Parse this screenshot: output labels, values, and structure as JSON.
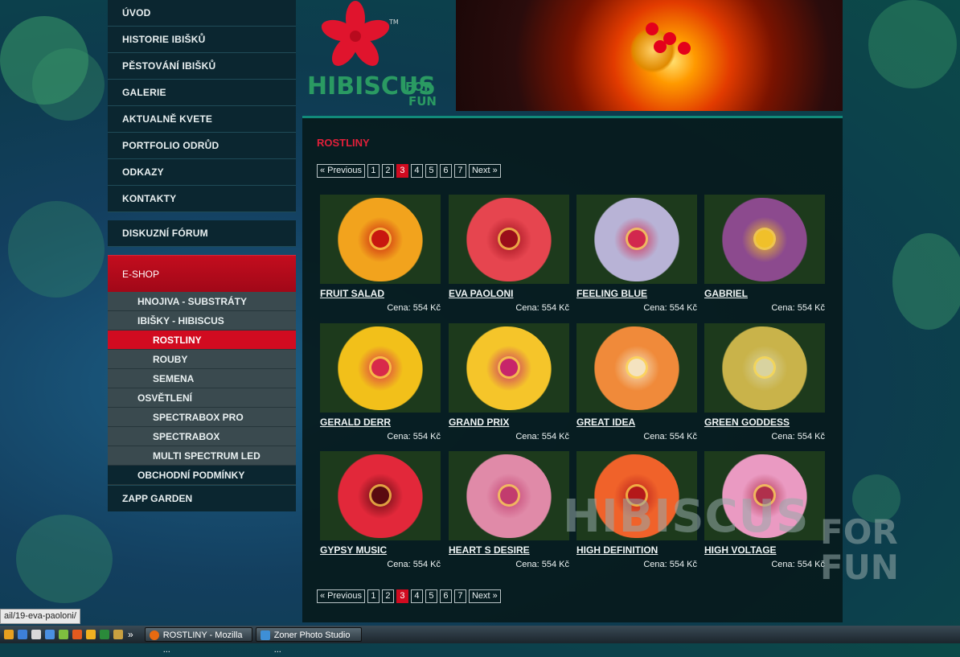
{
  "nav": {
    "main": [
      "ÚVOD",
      "HISTORIE IBIŠKŮ",
      "PĚSTOVÁNÍ IBIŠKŮ",
      "GALERIE",
      "AKTUALNĚ KVETE",
      "PORTFOLIO ODRŮD",
      "ODKAZY",
      "KONTAKTY"
    ],
    "forum": "DISKUZNÍ FÓRUM",
    "eshop": "E-SHOP",
    "sub": [
      {
        "label": "HNOJIVA - SUBSTRÁTY",
        "level": 2
      },
      {
        "label": "IBIŠKY - HIBISCUS",
        "level": 2
      },
      {
        "label": "ROSTLINY",
        "level": 3,
        "active": true
      },
      {
        "label": "ROUBY",
        "level": 3
      },
      {
        "label": "SEMENA",
        "level": 3
      },
      {
        "label": "OSVĚTLENÍ",
        "level": 2
      },
      {
        "label": "SPECTRABOX PRO",
        "level": 3
      },
      {
        "label": "SPECTRABOX",
        "level": 3
      },
      {
        "label": "MULTI SPECTRUM LED",
        "level": 3
      },
      {
        "label": "OBCHODNÍ PODMÍNKY",
        "level": 2,
        "dark": true
      }
    ],
    "zapp": "ZAPP GARDEN"
  },
  "logo": {
    "main": "HIBISCUS",
    "for": "FOR",
    "fun": "FUN",
    "tm": "TM"
  },
  "heading": "ROSTLINY",
  "pager": {
    "prev": "« Previous",
    "pages": [
      "1",
      "2",
      "3",
      "4",
      "5",
      "6",
      "7"
    ],
    "current": "3",
    "next": "Next »"
  },
  "products": [
    {
      "name": "FRUIT SALAD",
      "price": "Cena: 554 Kč",
      "petal": "#f2a31d",
      "eye": "#c8180f"
    },
    {
      "name": "EVA PAOLONI",
      "price": "Cena: 554 Kč",
      "petal": "#e6454f",
      "eye": "#9a0d1a"
    },
    {
      "name": "FEELING BLUE",
      "price": "Cena: 554 Kč",
      "petal": "#b8b3d6",
      "eye": "#d2284e"
    },
    {
      "name": "GABRIEL",
      "price": "Cena: 554 Kč",
      "petal": "#8c4a8e",
      "eye": "#f0c02a"
    },
    {
      "name": "GERALD DERR",
      "price": "Cena: 554 Kč",
      "petal": "#f2c01a",
      "eye": "#d82a4a"
    },
    {
      "name": "GRAND PRIX",
      "price": "Cena: 554 Kč",
      "petal": "#f5c52a",
      "eye": "#c7256a"
    },
    {
      "name": "GREAT IDEA",
      "price": "Cena: 554 Kč",
      "petal": "#f08a3a",
      "eye": "#f4e3c0"
    },
    {
      "name": "GREEN GODDESS",
      "price": "Cena: 554 Kč",
      "petal": "#c9b34a",
      "eye": "#d8d3a0"
    },
    {
      "name": "GYPSY MUSIC",
      "price": "Cena: 554 Kč",
      "petal": "#e2283a",
      "eye": "#5a0a10"
    },
    {
      "name": "HEART S DESIRE",
      "price": "Cena: 554 Kč",
      "petal": "#e08aa8",
      "eye": "#c23c6e"
    },
    {
      "name": "HIGH DEFINITION",
      "price": "Cena: 554 Kč",
      "petal": "#f0622a",
      "eye": "#b4181a"
    },
    {
      "name": "HIGH VOLTAGE",
      "price": "Cena: 554 Kč",
      "petal": "#ea9ac2",
      "eye": "#b0304c"
    }
  ],
  "watermark": {
    "main": "HIBISCUS",
    "for": "FOR",
    "fun": "FUN"
  },
  "status_url": "ail/19-eva-paoloni/",
  "taskbar": {
    "tasks": [
      "ROSTLINY - Mozilla ...",
      "Zoner Photo Studio ..."
    ],
    "overflow": "»"
  },
  "colors": {
    "accent_red": "#d10b20",
    "nav_dark": "#0b2630",
    "panel_border": "#118a7a"
  }
}
